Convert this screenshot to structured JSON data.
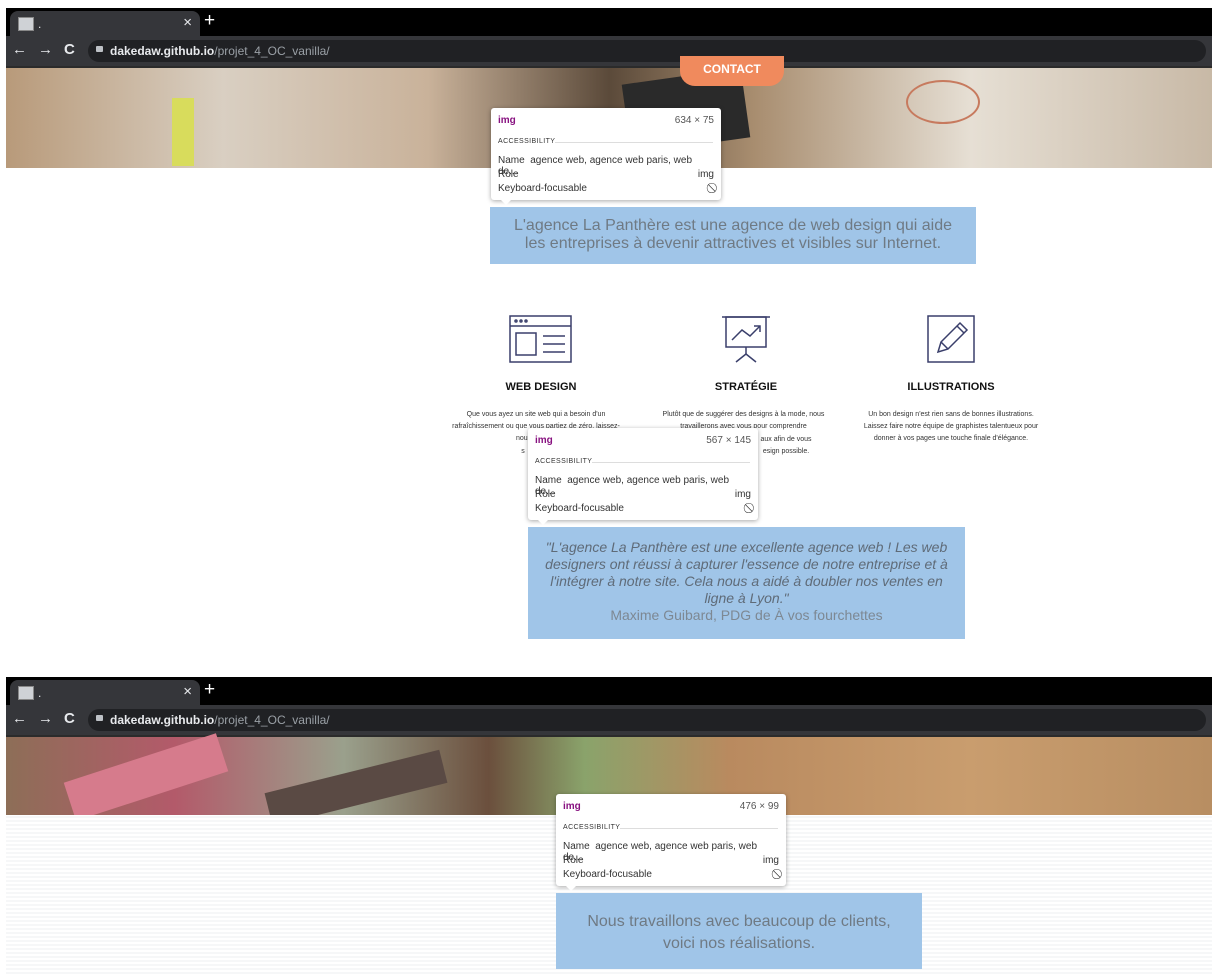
{
  "browser": {
    "tab_title": ".",
    "tab_close": "×",
    "new_tab": "+",
    "back": "←",
    "forward": "→",
    "reload": "C",
    "url_host": "dakedaw.github.io",
    "url_path": "/projet_4_OC_vanilla/"
  },
  "top_page": {
    "contact_button": "CONTACT",
    "tooltip1": {
      "tag": "img",
      "dims": "634 × 75",
      "section": "ACCESSIBILITY",
      "name_label": "Name",
      "name_value": "agence web, agence web paris, web de...",
      "role_label": "Role",
      "role_value": "img",
      "focus_label": "Keyboard-focusable"
    },
    "intro_text": "L'agence La Panthère est une agence de web design qui aide les entreprises à devenir attractives et visibles sur Internet.",
    "services": [
      {
        "title": "WEB DESIGN",
        "text": "Que vous ayez un site web qui a besoin d'un rafraîchissement ou que vous partiez de zéro, laissez-nous vous ré"
      },
      {
        "title": "STRATÉGIE",
        "text": "Plutôt que de suggérer des designs à la mode, nous travaillerons avec vous pour comprendre"
      },
      {
        "title": "ILLUSTRATIONS",
        "text": "Un bon design n'est rien sans de bonnes illustrations. Laissez faire notre équipe de graphistes talentueux pour donner à vos pages une touche finale d'élégance."
      }
    ],
    "service_fragments": {
      "left_tail": "s",
      "mid_tail1": "aux afin de vous",
      "mid_tail2": "esign possible."
    },
    "tooltip2": {
      "tag": "img",
      "dims": "567 × 145",
      "section": "ACCESSIBILITY",
      "name_label": "Name",
      "name_value": "agence web, agence web paris, web de...",
      "role_label": "Role",
      "role_value": "img",
      "focus_label": "Keyboard-focusable"
    },
    "testimonial_quote": "\"L'agence La Panthère est une excellente agence web ! Les web designers ont réussi à capturer l'essence de notre entreprise et à l'intégrer à notre site. Cela nous a aidé à doubler nos ventes en ligne à Lyon.\"",
    "testimonial_author": "Maxime Guibard, PDG de À vos fourchettes"
  },
  "bottom_page": {
    "tooltip3": {
      "tag": "img",
      "dims": "476 × 99",
      "section": "ACCESSIBILITY",
      "name_label": "Name",
      "name_value": "agence web, agence web paris, web de...",
      "role_label": "Role",
      "role_value": "img",
      "focus_label": "Keyboard-focusable"
    },
    "clients_text": "Nous travaillons avec beaucoup de clients, voici nos réalisations."
  },
  "colors": {
    "contact_button": "#f08a5d",
    "highlight": "#a0c5e8",
    "highlight_text": "#6f7a84",
    "icon_stroke": "#3a3f6b",
    "tooltip_tag": "#881280"
  },
  "icons": [
    "browser-window-icon",
    "presentation-chart-icon",
    "pencil-frame-icon",
    "lock-icon",
    "no-focus-icon"
  ]
}
